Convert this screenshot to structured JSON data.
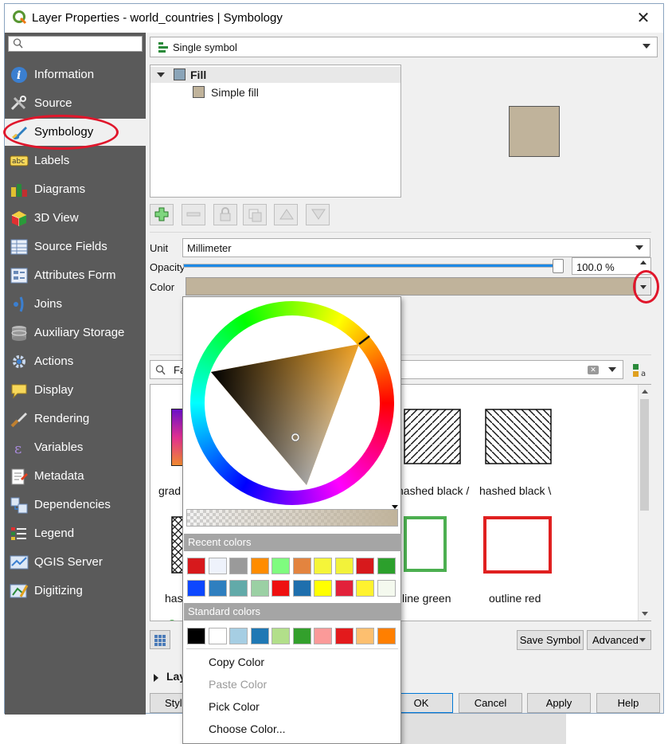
{
  "window": {
    "title": "Layer Properties - world_countries | Symbology",
    "close_glyph": "✕"
  },
  "sidebar": {
    "search_placeholder": "",
    "items": [
      {
        "label": "Information",
        "icon": "information-icon"
      },
      {
        "label": "Source",
        "icon": "source-tools-icon"
      },
      {
        "label": "Symbology",
        "icon": "paintbrush-icon"
      },
      {
        "label": "Labels",
        "icon": "labels-abc-icon"
      },
      {
        "label": "Diagrams",
        "icon": "diagrams-icon"
      },
      {
        "label": "3D View",
        "icon": "cube-icon"
      },
      {
        "label": "Source Fields",
        "icon": "fields-icon"
      },
      {
        "label": "Attributes Form",
        "icon": "form-icon"
      },
      {
        "label": "Joins",
        "icon": "joins-icon"
      },
      {
        "label": "Auxiliary Storage",
        "icon": "database-icon"
      },
      {
        "label": "Actions",
        "icon": "gear-icon"
      },
      {
        "label": "Display",
        "icon": "speech-bubble-icon"
      },
      {
        "label": "Rendering",
        "icon": "brush-icon"
      },
      {
        "label": "Variables",
        "icon": "epsilon-icon"
      },
      {
        "label": "Metadata",
        "icon": "metadata-icon"
      },
      {
        "label": "Dependencies",
        "icon": "dependencies-icon"
      },
      {
        "label": "Legend",
        "icon": "legend-icon"
      },
      {
        "label": "QGIS Server",
        "icon": "server-icon"
      },
      {
        "label": "Digitizing",
        "icon": "digitizing-icon"
      }
    ],
    "active_index": 2
  },
  "renderer": {
    "value": "Single symbol"
  },
  "symbol_tree": {
    "root": "Fill",
    "child": "Simple fill"
  },
  "unit": {
    "label": "Unit",
    "value": "Millimeter"
  },
  "opacity": {
    "label": "Opacity",
    "value": "100.0 %",
    "fraction": 1.0
  },
  "color": {
    "label": "Color",
    "value": "#c0b39b"
  },
  "library": {
    "search_value": "Fa",
    "items_row1": [
      "grad",
      "hashed black /",
      "hashed black \\"
    ],
    "items_row2": [
      "has",
      "line green",
      "outline red"
    ]
  },
  "bottom": {
    "save_symbol": "Save Symbol",
    "advanced": "Advanced",
    "layer_rendering": "Lay",
    "style": "Style",
    "ok": "OK",
    "cancel": "Cancel",
    "apply": "Apply",
    "help": "Help"
  },
  "color_popup": {
    "recent_label": "Recent colors",
    "standard_label": "Standard colors",
    "recent_colors": [
      "#d7191c",
      "#eef2fb",
      "#9a9a9a",
      "#ff8c00",
      "#7ffc7f",
      "#e3843f",
      "#f5f539",
      "#f2f23a",
      "#d7191c",
      "#2ca02c",
      "#0d47ff",
      "#2f7fbf",
      "#62aaa9",
      "#9bd0a4",
      "#ee1010",
      "#1f6fad",
      "#ffff00",
      "#e2213a",
      "#fff22f",
      "#f4f9ee"
    ],
    "standard_colors": [
      "#000000",
      "#ffffff",
      "#a6cee3",
      "#1f78b4",
      "#b2df8a",
      "#33a02c",
      "#fb9a99",
      "#e31a1c",
      "#fdbf6f",
      "#ff7f00"
    ],
    "menu": [
      {
        "label": "Copy Color",
        "disabled": false
      },
      {
        "label": "Paste Color",
        "disabled": true
      },
      {
        "label": "Pick Color",
        "disabled": false
      },
      {
        "label": "Choose Color...",
        "disabled": false
      }
    ]
  }
}
